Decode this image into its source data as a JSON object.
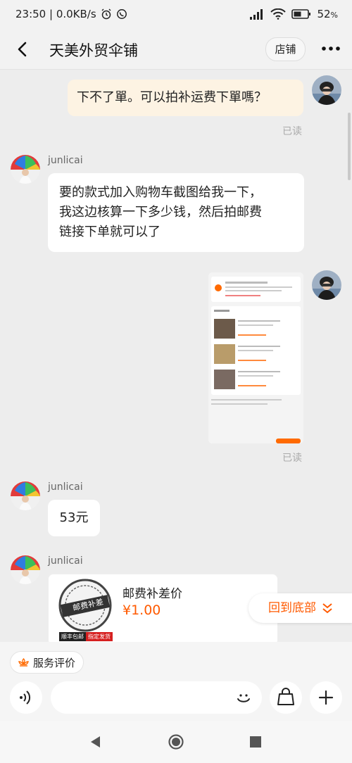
{
  "status_bar": {
    "time_speed": "23:50 | 0.0KB/s",
    "battery": "52",
    "battery_unit": "%"
  },
  "header": {
    "title": "天美外贸伞铺",
    "shop_button": "店铺"
  },
  "messages": {
    "me_text": "下不了單。可以拍补运费下單嗎？",
    "read_1": "已读",
    "seller_name_1": "junlicai",
    "seller_text_1_line1": "要的款式加入购物车截图给我一下，",
    "seller_text_1_line2": "我这边核算一下多少钱，然后拍邮费",
    "seller_text_1_line3": "链接下单就可以了",
    "read_2": "已读",
    "seller_name_2": "junlicai",
    "seller_text_2": "53元",
    "seller_name_3": "junlicai"
  },
  "screenshot_msg": {
    "line1": "韩伟-2042693...",
    "section": "购物车",
    "tag1": "满199元包邮",
    "tag2": "满199元包邮",
    "tag3": "满199元包邮"
  },
  "product_card": {
    "title": "邮费补差价",
    "price": "¥1.00",
    "stamp_text": "邮费补差",
    "badge_left": "顺丰包邮",
    "badge_right": "指定发货"
  },
  "scroll_bottom": {
    "label": "回到底部"
  },
  "bottom": {
    "eval_label": "服务评价"
  },
  "colors": {
    "accent": "#ff5a00",
    "me_bubble": "#fdf3e3",
    "background": "#ededed"
  }
}
